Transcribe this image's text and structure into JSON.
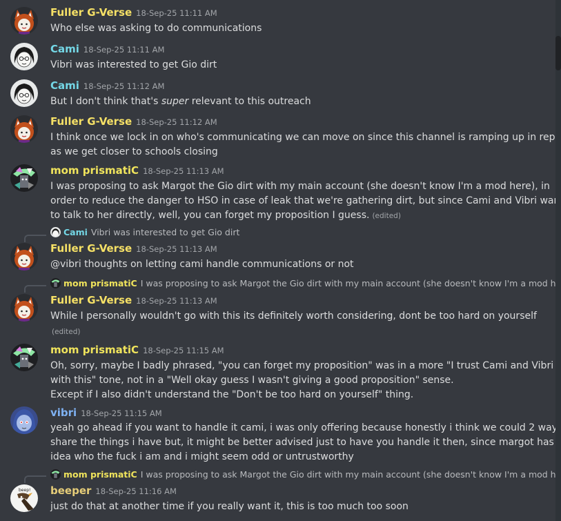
{
  "colors": {
    "fuller": "#f5e066",
    "cami": "#74d7e6",
    "mom": "#f0e45c",
    "vibri": "#7fb2f3",
    "beeper": "#e6cd79",
    "mention": "#e8e9ff"
  },
  "messages": [
    {
      "author": "Fuller G-Verse",
      "timestamp": "18-Sep-25 11:11 AM",
      "lines": [
        "Who else was asking to do communications"
      ]
    },
    {
      "author": "Cami",
      "timestamp": "18-Sep-25 11:11 AM",
      "lines": [
        "Vibri was interested to get Gio dirt"
      ]
    },
    {
      "author": "Cami",
      "timestamp": "18-Sep-25 11:12 AM",
      "line_pre": "But I don't think that's ",
      "line_em": "super",
      "line_post": " relevant to this outreach"
    },
    {
      "author": "Fuller G-Verse",
      "timestamp": "18-Sep-25 11:12 AM",
      "lines": [
        "I think once we lock in on who's communicating we can move on since this channel is ramping up in reports",
        "as we get closer to schools closing"
      ]
    },
    {
      "author": "mom prismatiC",
      "timestamp": "18-Sep-25 11:13 AM",
      "lines": [
        "I was proposing to ask Margot the Gio dirt with my main account (she doesn't know I'm a mod here), in",
        "order to reduce the danger to HSO in case of leak that we're gathering dirt, but since Cami and Vibri want",
        "to talk to her directly, well, you can forget my proposition I guess."
      ],
      "edited": "(edited)"
    },
    {
      "reply_author": "Cami",
      "reply_text": "Vibri was interested to get Gio dirt",
      "author": "Fuller G-Verse",
      "timestamp": "18-Sep-25 11:13 AM",
      "lines": [
        "@vibri thoughts on letting cami handle communications or not"
      ]
    },
    {
      "reply_author": "mom prismatiC",
      "reply_text": "I was proposing to ask Margot the Gio dirt with my main account (she doesn't know I'm a mod he...",
      "author": "Fuller G-Verse",
      "timestamp": "18-Sep-25 11:13 AM",
      "lines": [
        "While I personally wouldn't go with this its definitely worth considering, dont be too hard on yourself"
      ],
      "edited": "(edited)"
    },
    {
      "author": "mom prismatiC",
      "timestamp": "18-Sep-25 11:15 AM",
      "lines": [
        "Oh, sorry, maybe I badly phrased, \"you can forget my proposition\" was in a more \"I trust Cami and Vibri",
        "with this\" tone, not in a \"Well okay guess I wasn't giving a good proposition\" sense.",
        "Except if I also didn't understand the \"Don't be too hard on yourself\" thing."
      ]
    },
    {
      "author": "vibri",
      "timestamp": "18-Sep-25 11:15 AM",
      "lines": [
        "yeah go ahead if you want to handle it cami, i was only offering because honestly i think we could 2 way",
        "share the things i have but, it might be better advised just to have you handle it then, since margot has no",
        "idea who the fuck i am and i might seem odd or untrustworthy"
      ]
    },
    {
      "reply_author": "mom prismatiC",
      "reply_text": "I was proposing to ask Margot the Gio dirt with my main account (she doesn't know I'm a mod he...",
      "author": "beeper",
      "avatar_text": "beep!",
      "timestamp": "18-Sep-25 11:16 AM",
      "lines": [
        "just do that at another time if you really want it, this is too much too soon"
      ]
    }
  ]
}
